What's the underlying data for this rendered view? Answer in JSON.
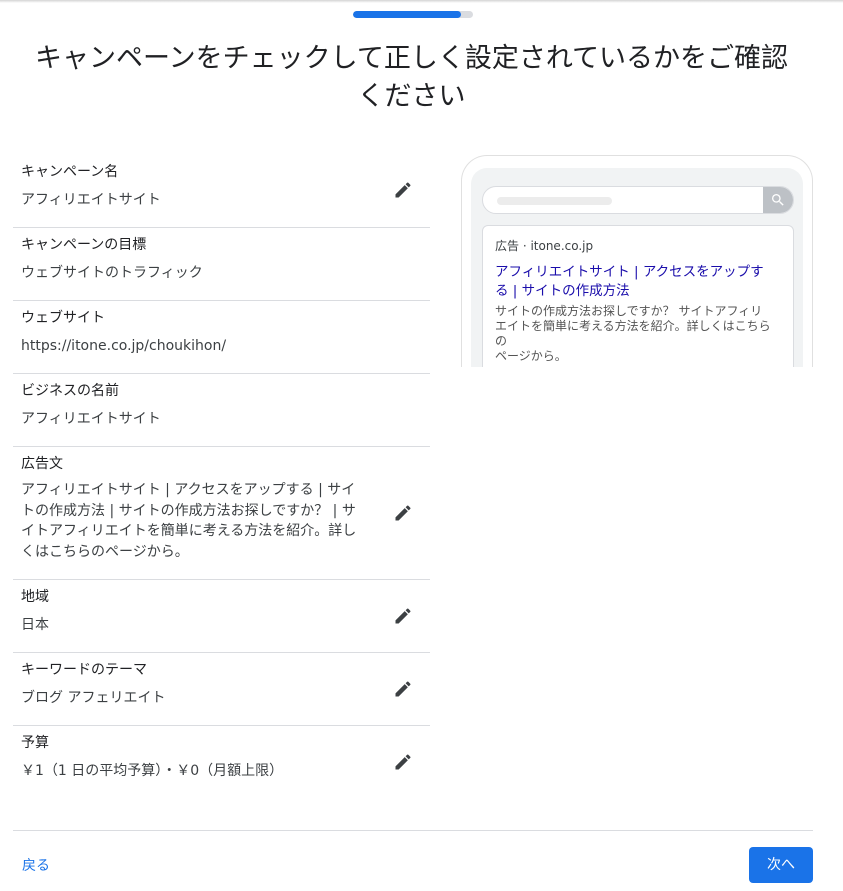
{
  "progress": {
    "fraction": 0.9
  },
  "page": {
    "title_line1": "キャンペーンをチェックして正しく設定されているかをご確認",
    "title_line2": "ください"
  },
  "summary": {
    "campaign_name": {
      "label": "キャンペーン名",
      "value": "アフィリエイトサイト"
    },
    "campaign_goal": {
      "label": "キャンペーンの目標",
      "value": "ウェブサイトのトラフィック"
    },
    "website": {
      "label": "ウェブサイト",
      "value": "https://itone.co.jp/choukihon/"
    },
    "business_name": {
      "label": "ビジネスの名前",
      "value": "アフィリエイトサイト"
    },
    "ad_text": {
      "label": "広告文",
      "lines": [
        "アフィリエイトサイト | アクセスをアップする | サイ",
        "トの作成方法 | サイトの作成方法お探しですか？ | サ",
        "イトアフィリエイトを簡単に考える方法を紹介。詳し",
        "くはこちらのページから。"
      ]
    },
    "region": {
      "label": "地域",
      "value": "日本"
    },
    "keyword_theme": {
      "label": "キーワードのテーマ",
      "value": "ブログ アフェリエイト"
    },
    "budget": {
      "label": "予算",
      "value": "￥1（1 日の平均予算）・￥0（月額上限）"
    }
  },
  "preview": {
    "ad_meta": "広告 · itone.co.jp",
    "headline_line1": "アフィリエイトサイト | アクセスをアップす",
    "headline_line2": "る | サイトの作成方法",
    "desc_line1": "サイトの作成方法お探しですか？ サイトアフィリ",
    "desc_line2": "エイトを簡単に考える方法を紹介。詳しくはこちらの",
    "desc_line3": "ページから。",
    "search_icon": "search-icon"
  },
  "footer": {
    "back_label": "戻る",
    "next_label": "次へ"
  },
  "colors": {
    "accent": "#1a73e8",
    "ad_headline": "#1a0dab",
    "divider": "#dadce0"
  },
  "icons": {
    "edit": "pencil-icon"
  }
}
